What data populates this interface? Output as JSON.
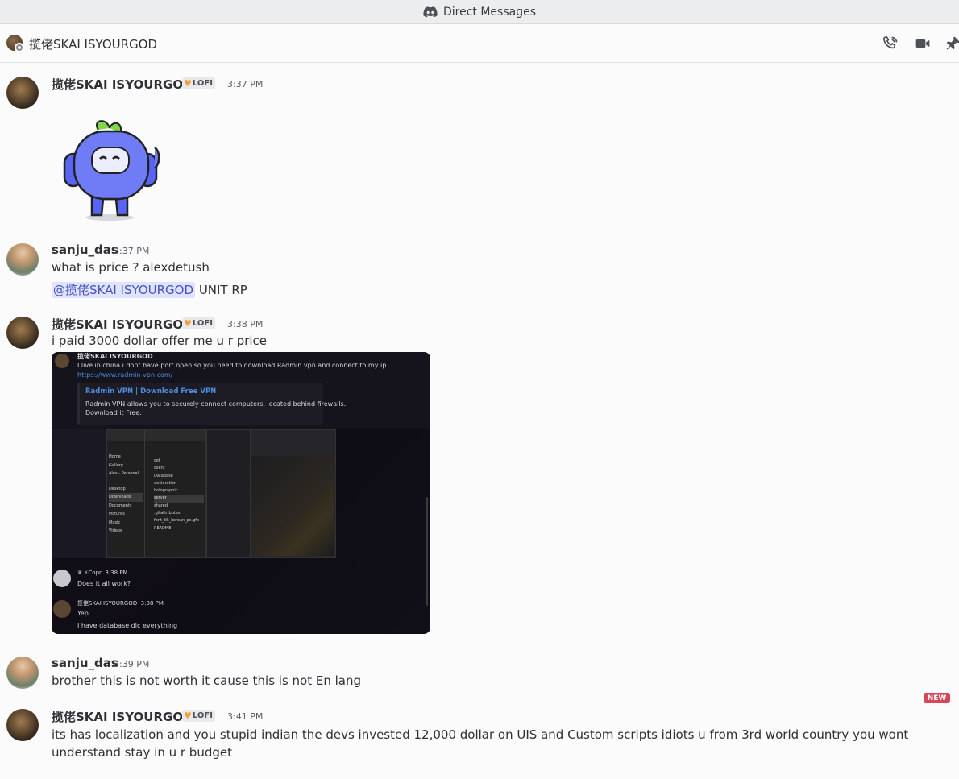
{
  "window": {
    "title": "Direct Messages"
  },
  "header": {
    "name": "揽佬SKAI ISYOURGOD"
  },
  "messages": [
    {
      "author": "揽佬SKAI ISYOURGOD",
      "tag": "LOFI",
      "time": "3:37 PM"
    },
    {
      "author": "sanju_das",
      "time": "3:37 PM",
      "lines": [
        "what is price ? alexdetush"
      ],
      "mention": "@揽佬SKAI ISYOURGOD",
      "after_mention": "UNIT RP"
    },
    {
      "author": "揽佬SKAI ISYOURGOD",
      "tag": "LOFI",
      "time": "3:38 PM",
      "text": "i paid 3000 dollar offer me u r price"
    },
    {
      "author": "sanju_das",
      "time": "3:39 PM",
      "text": "brother this is not worth it cause this is not En lang"
    },
    {
      "author": "揽佬SKAI ISYOURGOD",
      "tag": "LOFI",
      "time": "3:41 PM",
      "text": "its has localization and you stupid indian the devs invested 12,000 dollar on UIS and Custom scripts idiots u from 3rd world country you wont understand stay in u r budget"
    }
  ],
  "new_marker": "NEW",
  "screenshot": {
    "header_author": "揽佬SKAI ISYOURGOD",
    "msg1": "I live in china i dont have port open so you need to download Radmin vpn and connect to my ip",
    "link": "https://www.radmin-vpn.com/",
    "embed_title": "Radmin VPN | Download Free VPN",
    "embed_desc1": "Radmin VPN allows you to securely connect computers, located behind firewalls.",
    "embed_desc2": "Download it Free.",
    "explorer_folders": [
      "Home",
      "Gallery",
      "Alex - Personal",
      "Desktop",
      "Downloads",
      "Documents",
      "Pictures",
      "Music",
      "Videos"
    ],
    "explorer_files": [
      "cef",
      "client",
      "Database",
      "declaration",
      "holographic",
      "server",
      "shared",
      ".gitattributes",
      "font_tlk_korean_ps.gfx",
      "README"
    ],
    "reply1_author": "Copr",
    "reply1_time": "3:38 PM",
    "reply1_text": "Does it all work?",
    "reply2_author": "揽佬SKAI ISYOURGOD",
    "reply2_time": "3:38 PM",
    "reply2_line1": "Yep",
    "reply2_line2": "I have database dlc everything"
  }
}
